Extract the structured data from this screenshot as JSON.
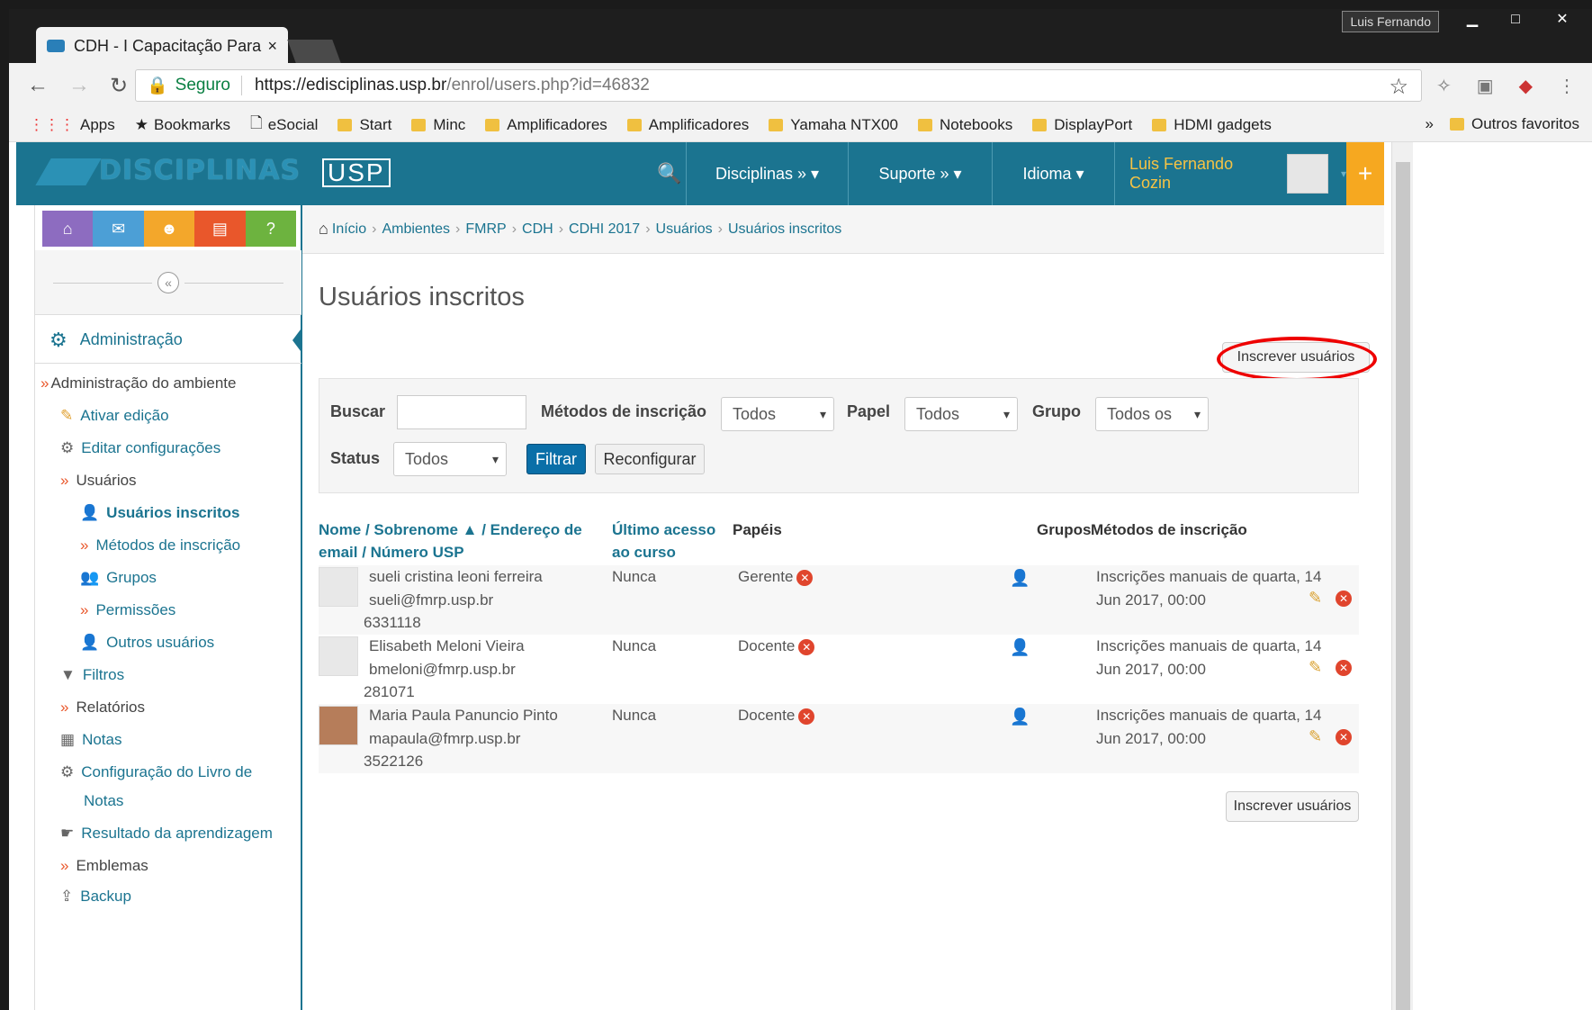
{
  "browser": {
    "tab_title": "CDH - I Capacitação Para",
    "user_badge": "Luis Fernando",
    "secure_label": "Seguro",
    "url_host": "https://edisciplinas.usp.br",
    "url_path": "/enrol/users.php?id=46832",
    "bookmarks": [
      "Apps",
      "Bookmarks",
      "eSocial",
      "Start",
      "Minc",
      "Amplificadores",
      "Amplificadores",
      "Yamaha NTX00",
      "Notebooks",
      "DisplayPort",
      "HDMI gadgets"
    ],
    "bookmarks_more": "»",
    "other_bookmarks": "Outros favoritos"
  },
  "header": {
    "logo": "DISCIPLINAS",
    "usp": "USP",
    "menus": [
      "Disciplinas » ▾",
      "Suporte » ▾",
      "Idioma ▾"
    ],
    "user": "Luis Fernando Cozin",
    "plus": "+"
  },
  "sidebar": {
    "collapse": "«",
    "admin_title": "Administração",
    "items": [
      {
        "label": "Administração do ambiente"
      },
      {
        "label": "Ativar edição"
      },
      {
        "label": "Editar configurações"
      },
      {
        "label": "Usuários"
      },
      {
        "label": "Usuários inscritos"
      },
      {
        "label": "Métodos de inscrição"
      },
      {
        "label": "Grupos"
      },
      {
        "label": "Permissões"
      },
      {
        "label": "Outros usuários"
      },
      {
        "label": "Filtros"
      },
      {
        "label": "Relatórios"
      },
      {
        "label": "Notas"
      },
      {
        "label": "Configuração do Livro de"
      },
      {
        "label": "Notas"
      },
      {
        "label": "Resultado da aprendizagem"
      },
      {
        "label": "Emblemas"
      },
      {
        "label": "Backup"
      }
    ]
  },
  "breadcrumb": [
    "Início",
    "Ambientes",
    "FMRP",
    "CDH",
    "CDHI 2017",
    "Usuários",
    "Usuários inscritos"
  ],
  "page": {
    "title": "Usuários inscritos",
    "enrol_button": "Inscrever usuários"
  },
  "filter": {
    "search_label": "Buscar",
    "search_value": "",
    "methods_label": "Métodos de inscrição",
    "methods_value": "Todos",
    "role_label": "Papel",
    "role_value": "Todos",
    "group_label": "Grupo",
    "group_value": "Todos os",
    "status_label": "Status",
    "status_value": "Todos",
    "filter_button": "Filtrar",
    "reset_button": "Reconfigurar"
  },
  "table": {
    "headers": {
      "name_line1": "Nome / Sobrenome ▲ / Endereço de",
      "name_line2": "email / Número USP",
      "access_line1": "Último acesso",
      "access_line2": "ao curso",
      "roles": "Papéis",
      "groups": "Grupos",
      "methods": "Métodos de inscrição"
    },
    "rows": [
      {
        "name": "sueli cristina leoni ferreira",
        "email": "sueli@fmrp.usp.br",
        "number": "6331118",
        "access": "Nunca",
        "role": "Gerente",
        "method_line1": "Inscrições manuais de quarta, 14",
        "method_line2": "Jun 2017, 00:00"
      },
      {
        "name": "Elisabeth Meloni Vieira",
        "email": "bmeloni@fmrp.usp.br",
        "number": "281071",
        "access": "Nunca",
        "role": "Docente",
        "method_line1": "Inscrições manuais de quarta, 14",
        "method_line2": "Jun 2017, 00:00"
      },
      {
        "name": "Maria Paula Panuncio Pinto",
        "email": "mapaula@fmrp.usp.br",
        "number": "3522126",
        "access": "Nunca",
        "role": "Docente",
        "method_line1": "Inscrições manuais de quarta, 14",
        "method_line2": "Jun 2017, 00:00"
      }
    ]
  },
  "colors": {
    "header": "#1b7490",
    "accent": "#f6a820",
    "link": "#1b7490",
    "highlight_ring": "#e00000"
  }
}
